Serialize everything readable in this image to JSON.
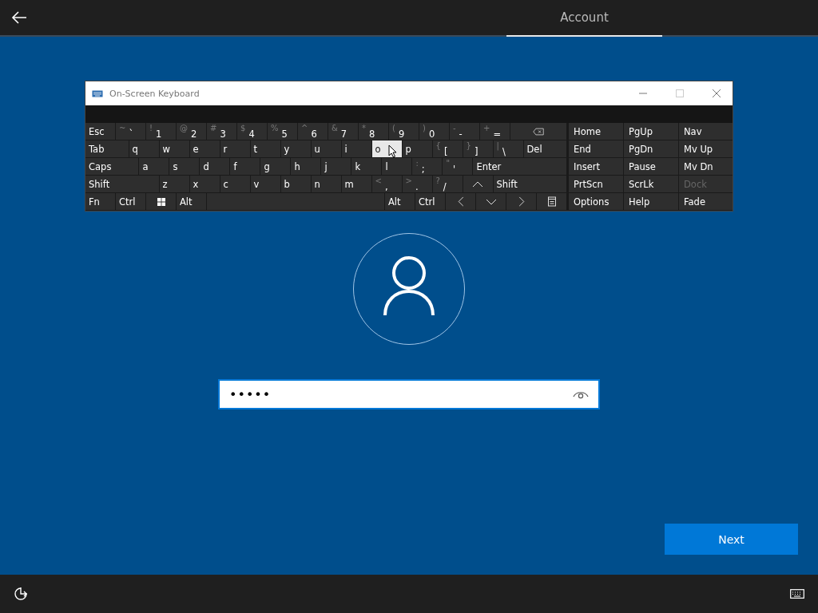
{
  "top_bar": {
    "tabs": [
      {
        "label": "Account",
        "selected": true
      }
    ]
  },
  "keyboard_window": {
    "title": "On-Screen Keyboard",
    "rows": [
      {
        "keys": [
          {
            "label": "Esc",
            "kind": "key",
            "selected": false
          },
          {
            "label": "`",
            "shift": "~",
            "kind": "key",
            "selected": false
          },
          {
            "label": "1",
            "shift": "!",
            "kind": "key",
            "selected": false
          },
          {
            "label": "2",
            "shift": "@",
            "kind": "key",
            "selected": false
          },
          {
            "label": "3",
            "shift": "#",
            "kind": "key",
            "selected": false
          },
          {
            "label": "4",
            "shift": "$",
            "kind": "key",
            "selected": false
          },
          {
            "label": "5",
            "shift": "%",
            "kind": "key",
            "selected": false
          },
          {
            "label": "6",
            "shift": "^",
            "kind": "key",
            "selected": false
          },
          {
            "label": "7",
            "shift": "&",
            "kind": "key",
            "selected": false
          },
          {
            "label": "8",
            "shift": "*",
            "kind": "key",
            "selected": false
          },
          {
            "label": "9",
            "shift": "(",
            "kind": "key",
            "selected": false
          },
          {
            "label": "0",
            "shift": ")",
            "kind": "key",
            "selected": false
          },
          {
            "label": "-",
            "shift": "-",
            "kind": "key",
            "selected": false
          },
          {
            "label": "=",
            "shift": "+",
            "kind": "key",
            "selected": false
          },
          {
            "kind": "backspace",
            "selected": false
          }
        ]
      },
      {
        "keys": [
          {
            "label": "Tab",
            "kind": "wide",
            "selected": false
          },
          {
            "label": "q",
            "kind": "key",
            "selected": false
          },
          {
            "label": "w",
            "kind": "key",
            "selected": false
          },
          {
            "label": "e",
            "kind": "key",
            "selected": false
          },
          {
            "label": "r",
            "kind": "key",
            "selected": false
          },
          {
            "label": "t",
            "kind": "key",
            "selected": false
          },
          {
            "label": "y",
            "kind": "key",
            "selected": false
          },
          {
            "label": "u",
            "kind": "key",
            "selected": false
          },
          {
            "label": "i",
            "kind": "key",
            "selected": false
          },
          {
            "label": "o",
            "kind": "key",
            "selected": true
          },
          {
            "label": "p",
            "kind": "key",
            "selected": false
          },
          {
            "label": "[",
            "shift": "{",
            "kind": "key",
            "selected": false
          },
          {
            "label": "]",
            "shift": "}",
            "kind": "key",
            "selected": false
          },
          {
            "label": "\\",
            "shift": "|",
            "kind": "key",
            "selected": false
          },
          {
            "label": "Del",
            "kind": "wide",
            "selected": false
          }
        ]
      },
      {
        "keys": [
          {
            "label": "Caps",
            "kind": "wide",
            "selected": false
          },
          {
            "label": "a",
            "kind": "key",
            "selected": false
          },
          {
            "label": "s",
            "kind": "key",
            "selected": false
          },
          {
            "label": "d",
            "kind": "key",
            "selected": false
          },
          {
            "label": "f",
            "kind": "key",
            "selected": false
          },
          {
            "label": "g",
            "kind": "key",
            "selected": false
          },
          {
            "label": "h",
            "kind": "key",
            "selected": false
          },
          {
            "label": "j",
            "kind": "key",
            "selected": false
          },
          {
            "label": "k",
            "kind": "key",
            "selected": false
          },
          {
            "label": "l",
            "kind": "key",
            "selected": false
          },
          {
            "label": ";",
            "shift": ":",
            "kind": "key",
            "selected": false
          },
          {
            "label": "'",
            "shift": "\"",
            "kind": "key",
            "selected": false
          },
          {
            "label": "Enter",
            "kind": "wide",
            "selected": false
          }
        ]
      },
      {
        "keys": [
          {
            "label": "Shift",
            "kind": "wide",
            "selected": false
          },
          {
            "label": "z",
            "kind": "key",
            "selected": false
          },
          {
            "label": "x",
            "kind": "key",
            "selected": false
          },
          {
            "label": "c",
            "kind": "key",
            "selected": false
          },
          {
            "label": "v",
            "kind": "key",
            "selected": false
          },
          {
            "label": "b",
            "kind": "key",
            "selected": false
          },
          {
            "label": "n",
            "kind": "key",
            "selected": false
          },
          {
            "label": "m",
            "kind": "key",
            "selected": false
          },
          {
            "label": ",",
            "shift": "<",
            "kind": "key",
            "selected": false
          },
          {
            "label": ".",
            "shift": ">",
            "kind": "key",
            "selected": false
          },
          {
            "label": "/",
            "shift": "?",
            "kind": "key",
            "selected": false
          },
          {
            "kind": "up",
            "selected": false
          },
          {
            "label": "Shift",
            "kind": "wide",
            "selected": false
          }
        ]
      },
      {
        "keys": [
          {
            "label": "Fn",
            "kind": "key",
            "selected": false
          },
          {
            "label": "Ctrl",
            "kind": "key",
            "selected": false
          },
          {
            "kind": "windows",
            "selected": false
          },
          {
            "label": "Alt",
            "kind": "key",
            "selected": false
          },
          {
            "kind": "space",
            "selected": false
          },
          {
            "label": "Alt",
            "kind": "key",
            "selected": false
          },
          {
            "label": "Ctrl",
            "kind": "key",
            "selected": false
          },
          {
            "kind": "left",
            "selected": false
          },
          {
            "kind": "down",
            "selected": false
          },
          {
            "kind": "right",
            "selected": false
          },
          {
            "kind": "menu",
            "selected": false
          }
        ]
      }
    ],
    "nav_keys": [
      {
        "label": "Home",
        "disabled": false
      },
      {
        "label": "PgUp",
        "disabled": false
      },
      {
        "label": "Nav",
        "disabled": false
      },
      {
        "label": "End",
        "disabled": false
      },
      {
        "label": "PgDn",
        "disabled": false
      },
      {
        "label": "Mv Up",
        "disabled": false
      },
      {
        "label": "Insert",
        "disabled": false
      },
      {
        "label": "Pause",
        "disabled": false
      },
      {
        "label": "Mv Dn",
        "disabled": false
      },
      {
        "label": "PrtScn",
        "disabled": false
      },
      {
        "label": "ScrLk",
        "disabled": false
      },
      {
        "label": "Dock",
        "disabled": true
      },
      {
        "label": "Options",
        "disabled": false
      },
      {
        "label": "Help",
        "disabled": false
      },
      {
        "label": "Fade",
        "disabled": false
      }
    ]
  },
  "password_field": {
    "value": "•••••"
  },
  "next_button": {
    "label": "Next"
  }
}
